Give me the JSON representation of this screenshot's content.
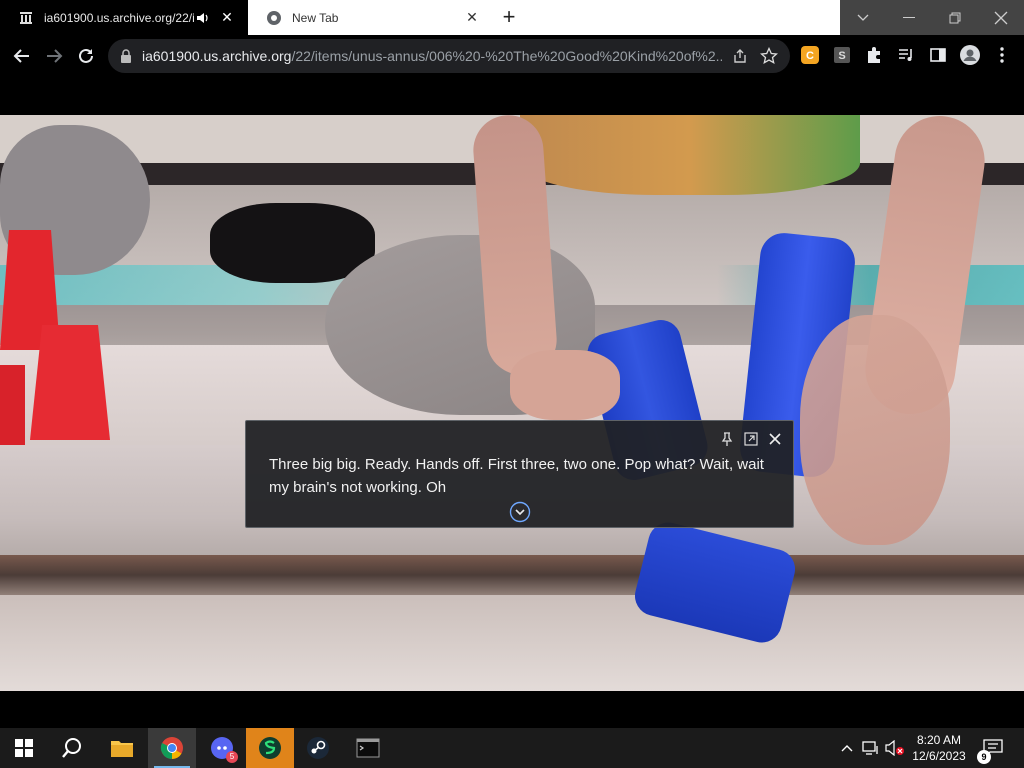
{
  "browser": {
    "tabs": [
      {
        "title": "ia601900.us.archive.org/22/i",
        "active": true,
        "audio": true
      },
      {
        "title": "New Tab",
        "active": false,
        "audio": false
      }
    ],
    "new_tab_label": "+",
    "address": {
      "host": "ia601900.us.archive.org",
      "path": "/22/items/unus-annus/006%20-%20The%20Good%20Kind%20of%2..."
    },
    "extensions": [
      "coupon-extension-icon",
      "s-extension-icon",
      "puzzle-extensions-icon",
      "media-control-icon",
      "side-panel-icon",
      "profile-avatar-icon",
      "menu-icon"
    ]
  },
  "caption": {
    "text": "Three big big. Ready. Hands off. First three, two one. Pop what? Wait, wait my brain's not working. Oh"
  },
  "taskbar": {
    "apps": [
      "windows-start",
      "search",
      "file-explorer",
      "chrome",
      "discord",
      "app-s",
      "steam",
      "terminal"
    ],
    "discord_badge": "5",
    "clock_time": "8:20 AM",
    "clock_date": "12/6/2023",
    "notification_count": "9"
  },
  "colors": {
    "taskbar": "#1b1b1b",
    "toolbar": "#000000",
    "caption_bg": "#202124",
    "accent": "#76b9ed",
    "cups_blue": "#2a4bd6",
    "cups_red": "#e8252d"
  }
}
